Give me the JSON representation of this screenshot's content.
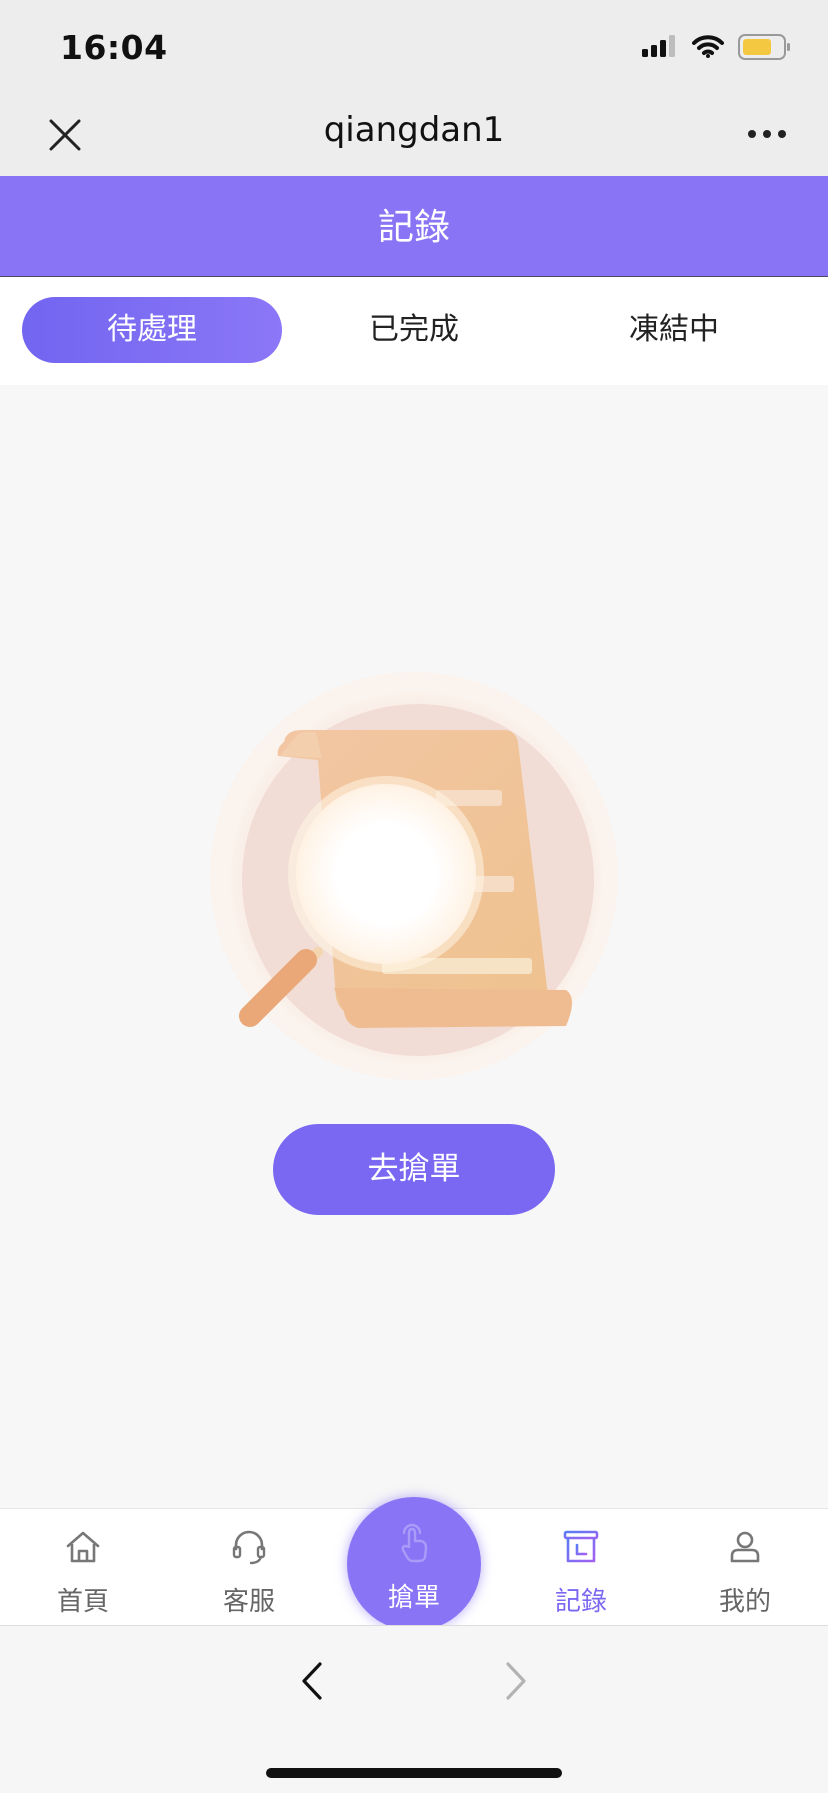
{
  "status": {
    "time": "16:04"
  },
  "nav": {
    "title": "qiangdan1"
  },
  "page": {
    "title": "記錄"
  },
  "tabs": [
    {
      "label": "待處理",
      "active": true
    },
    {
      "label": "已完成",
      "active": false
    },
    {
      "label": "凍結中",
      "active": false
    }
  ],
  "empty_state": {
    "illustration": "empty-search-illustration",
    "button_label": "去搶單"
  },
  "tabbar": {
    "items": [
      {
        "label": "首頁",
        "icon": "home-icon",
        "active": false
      },
      {
        "label": "客服",
        "icon": "headset-icon",
        "active": false
      },
      {
        "label": "搶單",
        "icon": "tap-hand-icon",
        "active": false
      },
      {
        "label": "記錄",
        "icon": "records-icon",
        "active": true
      },
      {
        "label": "我的",
        "icon": "user-icon",
        "active": false
      }
    ]
  },
  "colors": {
    "accent": "#8a74f6",
    "button": "#7a68f2",
    "active_label": "#7b68f2"
  }
}
